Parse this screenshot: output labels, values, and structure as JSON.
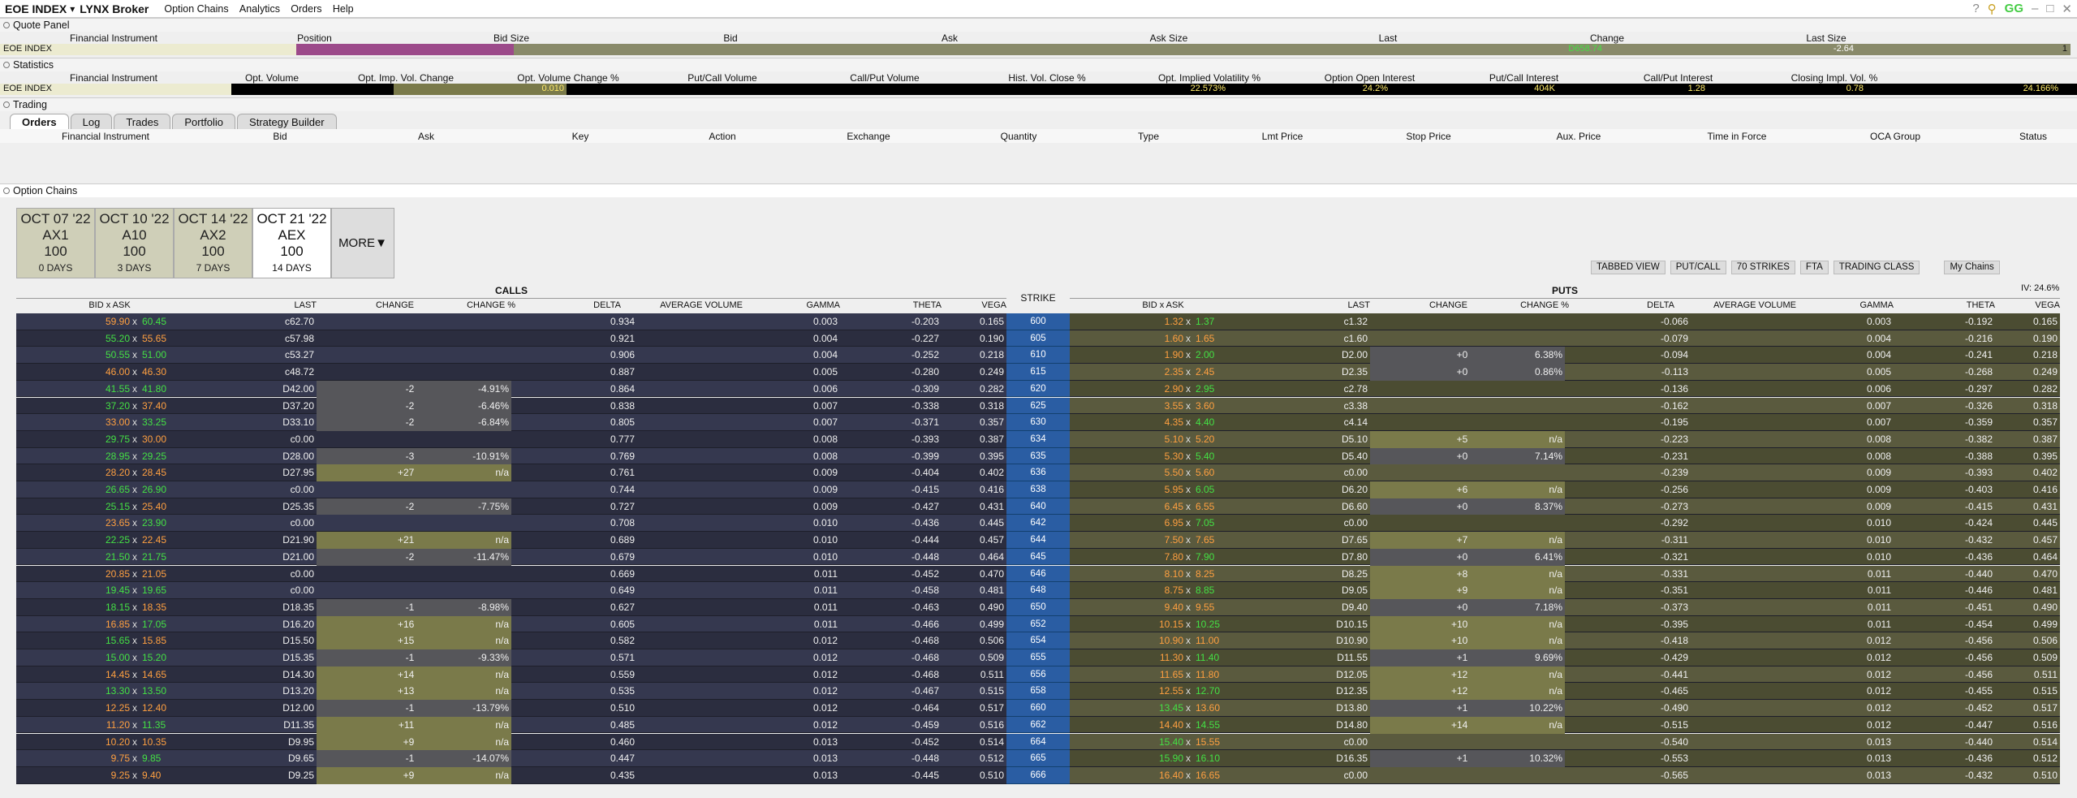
{
  "window": {
    "title": "EOE INDEX",
    "broker": "LYNX Broker",
    "menu": [
      "Option Chains",
      "Analytics",
      "Orders",
      "Help"
    ]
  },
  "quote": {
    "title": "Quote Panel",
    "headers": [
      "Financial Instrument",
      "Position",
      "Bid Size",
      "Bid",
      "Ask",
      "Ask Size",
      "Last",
      "Change",
      "Last Size"
    ],
    "instrument": "EOE INDEX",
    "last": "D658.74",
    "change": "-2.64",
    "last_size": "1"
  },
  "stats": {
    "title": "Statistics",
    "headers": [
      "Financial Instrument",
      "Opt. Volume",
      "Opt. Imp. Vol. Change",
      "Opt. Volume Change %",
      "Put/Call Volume",
      "Call/Put Volume",
      "Hist. Vol. Close %",
      "Opt. Implied Volatility %",
      "Option Open Interest",
      "Put/Call Interest",
      "Call/Put Interest",
      "Closing Impl. Vol. %"
    ],
    "instrument": "EOE INDEX",
    "imp_vol_change": "0.010",
    "hist_vol": "22.573%",
    "impl_vol": "24.2%",
    "open_interest": "404K",
    "pc_interest": "1.28",
    "cp_interest": "0.78",
    "closing_iv": "24.166%"
  },
  "trading": {
    "title": "Trading",
    "tabs": [
      "Orders",
      "Log",
      "Trades",
      "Portfolio",
      "Strategy Builder"
    ],
    "headers": [
      "Financial Instrument",
      "Bid",
      "Ask",
      "Key",
      "Action",
      "Exchange",
      "Quantity",
      "Type",
      "Lmt Price",
      "Stop Price",
      "Aux. Price",
      "Time in Force",
      "OCA Group",
      "Status"
    ]
  },
  "chains": {
    "title": "Option Chains",
    "expiries": [
      {
        "date": "OCT 07 '22",
        "code": "AX1",
        "mult": "100",
        "days": "0 DAYS"
      },
      {
        "date": "OCT 10 '22",
        "code": "A10",
        "mult": "100",
        "days": "3 DAYS"
      },
      {
        "date": "OCT 14 '22",
        "code": "AX2",
        "mult": "100",
        "days": "7 DAYS"
      },
      {
        "date": "OCT 21 '22",
        "code": "AEX",
        "mult": "100",
        "days": "14 DAYS"
      }
    ],
    "more": "MORE",
    "controls": [
      "TABBED VIEW",
      "PUT/CALL",
      "70 STRIKES",
      "FTA",
      "TRADING CLASS"
    ],
    "my_chains": "My Chains",
    "iv": "IV: 24.6%",
    "calls_label": "CALLS",
    "puts_label": "PUTS",
    "strike_label": "STRIKE",
    "col_headers": [
      "BID  x  ASK",
      "LAST",
      "CHANGE",
      "CHANGE %",
      "DELTA",
      "AVERAGE VOLUME",
      "GAMMA",
      "THETA",
      "VEGA"
    ],
    "strikes": [
      "600",
      "605",
      "610",
      "615",
      "620",
      "625",
      "630",
      "634",
      "635",
      "636",
      "638",
      "640",
      "642",
      "644",
      "645",
      "646",
      "648",
      "650",
      "652",
      "654",
      "655",
      "656",
      "658",
      "660",
      "662",
      "664",
      "665",
      "666"
    ],
    "calls": [
      [
        "59.90",
        "60.45",
        "c62.70",
        "",
        "",
        "0.934",
        "0.003",
        "-0.203",
        "0.165"
      ],
      [
        "55.20",
        "55.65",
        "c57.98",
        "",
        "",
        "0.921",
        "0.004",
        "-0.227",
        "0.190"
      ],
      [
        "50.55",
        "51.00",
        "c53.27",
        "",
        "",
        "0.906",
        "0.004",
        "-0.252",
        "0.218"
      ],
      [
        "46.00",
        "46.30",
        "c48.72",
        "",
        "",
        "0.887",
        "0.005",
        "-0.280",
        "0.249"
      ],
      [
        "41.55",
        "41.80",
        "D42.00",
        "-2.17",
        "-4.91%",
        "0.864",
        "0.006",
        "-0.309",
        "0.282"
      ],
      [
        "37.20",
        "37.40",
        "D37.20",
        "-2.57",
        "-6.46%",
        "0.838",
        "0.007",
        "-0.338",
        "0.318"
      ],
      [
        "33.00",
        "33.25",
        "D33.10",
        "-2.43",
        "-6.84%",
        "0.805",
        "0.007",
        "-0.371",
        "0.357"
      ],
      [
        "29.75",
        "30.00",
        "c0.00",
        "",
        "",
        "0.777",
        "0.008",
        "-0.393",
        "0.387"
      ],
      [
        "28.95",
        "29.25",
        "D28.00",
        "-3.43",
        "-10.91%",
        "0.769",
        "0.008",
        "-0.399",
        "0.395"
      ],
      [
        "28.20",
        "28.45",
        "D27.95",
        "+27.95",
        "n/a",
        "0.761",
        "0.009",
        "-0.404",
        "0.402"
      ],
      [
        "26.65",
        "26.90",
        "c0.00",
        "",
        "",
        "0.744",
        "0.009",
        "-0.415",
        "0.416"
      ],
      [
        "25.15",
        "25.40",
        "D25.35",
        "-2.13",
        "-7.75%",
        "0.727",
        "0.009",
        "-0.427",
        "0.431"
      ],
      [
        "23.65",
        "23.90",
        "c0.00",
        "",
        "",
        "0.708",
        "0.010",
        "-0.436",
        "0.445"
      ],
      [
        "22.25",
        "22.45",
        "D21.90",
        "+21.90",
        "n/a",
        "0.689",
        "0.010",
        "-0.444",
        "0.457"
      ],
      [
        "21.50",
        "21.75",
        "D21.00",
        "-2.72",
        "-11.47%",
        "0.679",
        "0.010",
        "-0.448",
        "0.464"
      ],
      [
        "20.85",
        "21.05",
        "c0.00",
        "",
        "",
        "0.669",
        "0.011",
        "-0.452",
        "0.470"
      ],
      [
        "19.45",
        "19.65",
        "c0.00",
        "",
        "",
        "0.649",
        "0.011",
        "-0.458",
        "0.481"
      ],
      [
        "18.15",
        "18.35",
        "D18.35",
        "-1.81",
        "-8.98%",
        "0.627",
        "0.011",
        "-0.463",
        "0.490"
      ],
      [
        "16.85",
        "17.05",
        "D16.20",
        "+16.20",
        "n/a",
        "0.605",
        "0.011",
        "-0.466",
        "0.499"
      ],
      [
        "15.65",
        "15.85",
        "D15.50",
        "+15.50",
        "n/a",
        "0.582",
        "0.012",
        "-0.468",
        "0.506"
      ],
      [
        "15.00",
        "15.20",
        "D15.35",
        "-1.58",
        "-9.33%",
        "0.571",
        "0.012",
        "-0.468",
        "0.509"
      ],
      [
        "14.45",
        "14.65",
        "D14.30",
        "+14.30",
        "n/a",
        "0.559",
        "0.012",
        "-0.468",
        "0.511"
      ],
      [
        "13.30",
        "13.50",
        "D13.20",
        "+13.20",
        "n/a",
        "0.535",
        "0.012",
        "-0.467",
        "0.515"
      ],
      [
        "12.25",
        "12.40",
        "D12.00",
        "-1.92",
        "-13.79%",
        "0.510",
        "0.012",
        "-0.464",
        "0.517"
      ],
      [
        "11.20",
        "11.35",
        "D11.35",
        "+11.35",
        "n/a",
        "0.485",
        "0.012",
        "-0.459",
        "0.516"
      ],
      [
        "10.20",
        "10.35",
        "D9.95",
        "+9.95",
        "n/a",
        "0.460",
        "0.013",
        "-0.452",
        "0.514"
      ],
      [
        "9.75",
        "9.85",
        "D9.65",
        "-1.58",
        "-14.07%",
        "0.447",
        "0.013",
        "-0.448",
        "0.512"
      ],
      [
        "9.25",
        "9.40",
        "D9.25",
        "+9.25",
        "n/a",
        "0.435",
        "0.013",
        "-0.445",
        "0.510"
      ]
    ],
    "puts": [
      [
        "1.32",
        "1.37",
        "c1.32",
        "",
        "",
        "-0.066",
        "0.003",
        "-0.192",
        "0.165"
      ],
      [
        "1.60",
        "1.65",
        "c1.60",
        "",
        "",
        "-0.079",
        "0.004",
        "-0.216",
        "0.190"
      ],
      [
        "1.90",
        "2.00",
        "D2.00",
        "+0.12",
        "6.38%",
        "-0.094",
        "0.004",
        "-0.241",
        "0.218"
      ],
      [
        "2.35",
        "2.45",
        "D2.35",
        "+0.02",
        "0.86%",
        "-0.113",
        "0.005",
        "-0.268",
        "0.249"
      ],
      [
        "2.90",
        "2.95",
        "c2.78",
        "",
        "",
        "-0.136",
        "0.006",
        "-0.297",
        "0.282"
      ],
      [
        "3.55",
        "3.60",
        "c3.38",
        "",
        "",
        "-0.162",
        "0.007",
        "-0.326",
        "0.318"
      ],
      [
        "4.35",
        "4.40",
        "c4.14",
        "",
        "",
        "-0.195",
        "0.007",
        "-0.359",
        "0.357"
      ],
      [
        "5.10",
        "5.20",
        "D5.10",
        "+5.10",
        "n/a",
        "-0.223",
        "0.008",
        "-0.382",
        "0.387"
      ],
      [
        "5.30",
        "5.40",
        "D5.40",
        "+0.36",
        "7.14%",
        "-0.231",
        "0.008",
        "-0.388",
        "0.395"
      ],
      [
        "5.50",
        "5.60",
        "c0.00",
        "",
        "",
        "-0.239",
        "0.009",
        "-0.393",
        "0.402"
      ],
      [
        "5.95",
        "6.05",
        "D6.20",
        "+6.20",
        "n/a",
        "-0.256",
        "0.009",
        "-0.403",
        "0.416"
      ],
      [
        "6.45",
        "6.55",
        "D6.60",
        "+0.51",
        "8.37%",
        "-0.273",
        "0.009",
        "-0.415",
        "0.431"
      ],
      [
        "6.95",
        "7.05",
        "c0.00",
        "",
        "",
        "-0.292",
        "0.010",
        "-0.424",
        "0.445"
      ],
      [
        "7.50",
        "7.65",
        "D7.65",
        "+7.65",
        "n/a",
        "-0.311",
        "0.010",
        "-0.432",
        "0.457"
      ],
      [
        "7.80",
        "7.90",
        "D7.80",
        "+0.47",
        "6.41%",
        "-0.321",
        "0.010",
        "-0.436",
        "0.464"
      ],
      [
        "8.10",
        "8.25",
        "D8.25",
        "+8.25",
        "n/a",
        "-0.331",
        "0.011",
        "-0.440",
        "0.470"
      ],
      [
        "8.75",
        "8.85",
        "D9.05",
        "+9.05",
        "n/a",
        "-0.351",
        "0.011",
        "-0.446",
        "0.481"
      ],
      [
        "9.40",
        "9.55",
        "D9.40",
        "+0.63",
        "7.18%",
        "-0.373",
        "0.011",
        "-0.451",
        "0.490"
      ],
      [
        "10.15",
        "10.25",
        "D10.15",
        "+10.15",
        "n/a",
        "-0.395",
        "0.011",
        "-0.454",
        "0.499"
      ],
      [
        "10.90",
        "11.00",
        "D10.90",
        "+10.90",
        "n/a",
        "-0.418",
        "0.012",
        "-0.456",
        "0.506"
      ],
      [
        "11.30",
        "11.40",
        "D11.55",
        "+1.02",
        "9.69%",
        "-0.429",
        "0.012",
        "-0.456",
        "0.509"
      ],
      [
        "11.65",
        "11.80",
        "D12.05",
        "+12.05",
        "n/a",
        "-0.441",
        "0.012",
        "-0.456",
        "0.511"
      ],
      [
        "12.55",
        "12.70",
        "D12.35",
        "+12.35",
        "n/a",
        "-0.465",
        "0.012",
        "-0.455",
        "0.515"
      ],
      [
        "13.45",
        "13.60",
        "D13.80",
        "+1.28",
        "10.22%",
        "-0.490",
        "0.012",
        "-0.452",
        "0.517"
      ],
      [
        "14.40",
        "14.55",
        "D14.80",
        "+14.80",
        "n/a",
        "-0.515",
        "0.012",
        "-0.447",
        "0.516"
      ],
      [
        "15.40",
        "15.55",
        "c0.00",
        "",
        "",
        "-0.540",
        "0.013",
        "-0.440",
        "0.514"
      ],
      [
        "15.90",
        "16.10",
        "D16.35",
        "+1.53",
        "10.32%",
        "-0.553",
        "0.013",
        "-0.436",
        "0.512"
      ],
      [
        "16.40",
        "16.65",
        "c0.00",
        "",
        "",
        "-0.565",
        "0.013",
        "-0.432",
        "0.510"
      ]
    ]
  }
}
